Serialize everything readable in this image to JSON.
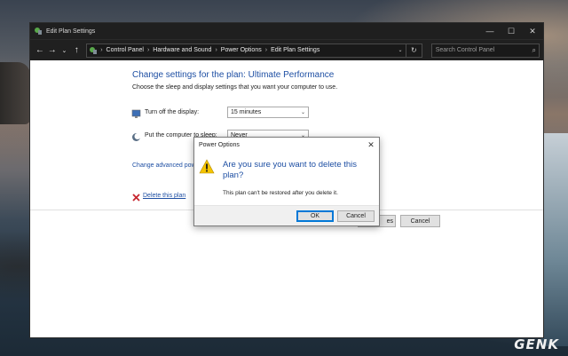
{
  "window": {
    "title": "Edit Plan Settings",
    "controls": {
      "minimize": "—",
      "maximize": "☐",
      "close": "✕"
    }
  },
  "addressbar": {
    "back": "←",
    "forward": "→",
    "recent": "⌄",
    "up": "↑",
    "breadcrumb": [
      "Control Panel",
      "Hardware and Sound",
      "Power Options",
      "Edit Plan Settings"
    ],
    "separator": "›",
    "dropdown": "⌄",
    "refresh": "↻",
    "search_placeholder": "Search Control Panel",
    "search_icon": "⌕"
  },
  "main": {
    "heading": "Change settings for the plan: Ultimate Performance",
    "subtext": "Choose the sleep and display settings that you want your computer to use.",
    "display_label": "Turn off the display:",
    "display_value": "15 minutes",
    "sleep_label": "Put the computer to sleep:",
    "sleep_value": "Never",
    "advanced_link": "Change advanced pow",
    "delete_link": "Delete this plan",
    "save_button": "es",
    "cancel_button": "Cancel",
    "select_arrow": "⌄"
  },
  "dialog": {
    "title": "Power Options",
    "close": "✕",
    "heading": "Are you sure you want to delete this plan?",
    "text": "This plan can't be restored after you delete it.",
    "ok": "OK",
    "cancel": "Cancel"
  },
  "watermark": "GENK",
  "colors": {
    "link_blue": "#1e4fa3",
    "title_bar": "#1f1f1f",
    "warning_yellow": "#f5c400",
    "delete_red": "#c6262e",
    "focus_blue": "#0078d7"
  },
  "icons": {
    "title": "power-options-icon",
    "address": "control-panel-icon",
    "display": "monitor-icon",
    "sleep": "moon-icon",
    "delete": "red-x-icon",
    "dialog": "warning-icon"
  }
}
